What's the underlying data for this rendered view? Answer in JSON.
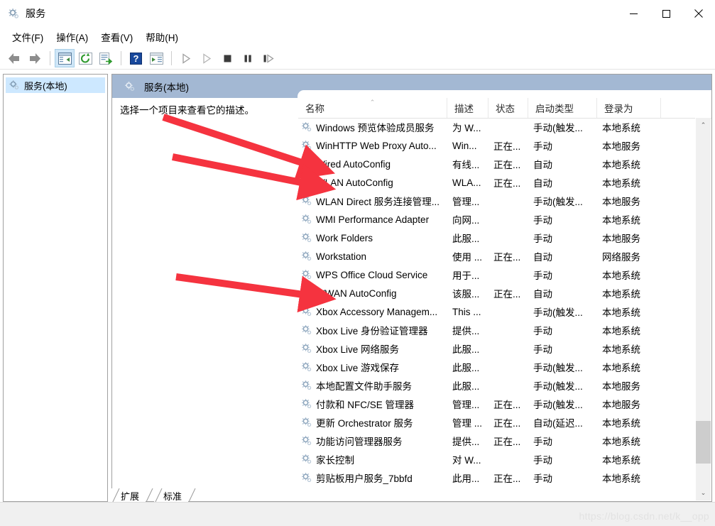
{
  "window": {
    "title": "服务",
    "icon": "services-gear-icon",
    "minimize_label": "最小化",
    "maximize_label": "最大化",
    "close_label": "关闭"
  },
  "menubar": {
    "items": [
      {
        "label": "文件(F)",
        "name": "menu-file"
      },
      {
        "label": "操作(A)",
        "name": "menu-action"
      },
      {
        "label": "查看(V)",
        "name": "menu-view"
      },
      {
        "label": "帮助(H)",
        "name": "menu-help"
      }
    ]
  },
  "toolbar": {
    "buttons": [
      {
        "name": "back-icon",
        "icon": "arrow-left"
      },
      {
        "name": "forward-icon",
        "icon": "arrow-right"
      },
      {
        "name": "show-hide-console-tree-icon",
        "icon": "panel"
      },
      {
        "name": "refresh-icon",
        "icon": "refresh"
      },
      {
        "name": "export-list-icon",
        "icon": "export"
      },
      {
        "name": "help-icon",
        "icon": "help"
      },
      {
        "name": "show-action-pane-icon",
        "icon": "action-panel"
      },
      {
        "name": "start-service-icon",
        "icon": "play"
      },
      {
        "name": "resume-service-icon",
        "icon": "play-outline"
      },
      {
        "name": "stop-service-icon",
        "icon": "stop"
      },
      {
        "name": "pause-service-icon",
        "icon": "pause"
      },
      {
        "name": "restart-service-icon",
        "icon": "restart"
      }
    ]
  },
  "tree": {
    "node_label": "服务(本地)",
    "node_icon": "services-gear-icon"
  },
  "pane": {
    "banner_title": "服务(本地)",
    "banner_icon": "services-gear-icon",
    "description_hint": "选择一个项目来查看它的描述。"
  },
  "list": {
    "columns": [
      {
        "label": "名称",
        "name": "column-name",
        "sorted": "asc"
      },
      {
        "label": "描述",
        "name": "column-description"
      },
      {
        "label": "状态",
        "name": "column-status"
      },
      {
        "label": "启动类型",
        "name": "column-startup-type"
      },
      {
        "label": "登录为",
        "name": "column-log-on-as"
      }
    ],
    "rows": [
      {
        "name": "Windows 预览体验成员服务",
        "description": "为 W...",
        "status": "",
        "startup": "手动(触发...",
        "logon": "本地系统"
      },
      {
        "name": "WinHTTP Web Proxy Auto...",
        "description": "Win...",
        "status": "正在...",
        "startup": "手动",
        "logon": "本地服务"
      },
      {
        "name": "Wired AutoConfig",
        "description": "有线...",
        "status": "正在...",
        "startup": "自动",
        "logon": "本地系统"
      },
      {
        "name": "WLAN AutoConfig",
        "description": "WLA...",
        "status": "正在...",
        "startup": "自动",
        "logon": "本地系统"
      },
      {
        "name": "WLAN Direct 服务连接管理...",
        "description": "管理...",
        "status": "",
        "startup": "手动(触发...",
        "logon": "本地服务"
      },
      {
        "name": "WMI Performance Adapter",
        "description": "向网...",
        "status": "",
        "startup": "手动",
        "logon": "本地系统"
      },
      {
        "name": "Work Folders",
        "description": "此服...",
        "status": "",
        "startup": "手动",
        "logon": "本地服务"
      },
      {
        "name": "Workstation",
        "description": "使用 ...",
        "status": "正在...",
        "startup": "自动",
        "logon": "网络服务"
      },
      {
        "name": "WPS Office Cloud Service",
        "description": "用于...",
        "status": "",
        "startup": "手动",
        "logon": "本地系统"
      },
      {
        "name": "WWAN AutoConfig",
        "description": "该服...",
        "status": "正在...",
        "startup": "自动",
        "logon": "本地系统"
      },
      {
        "name": "Xbox Accessory Managem...",
        "description": "This ...",
        "status": "",
        "startup": "手动(触发...",
        "logon": "本地系统"
      },
      {
        "name": "Xbox Live 身份验证管理器",
        "description": "提供...",
        "status": "",
        "startup": "手动",
        "logon": "本地系统"
      },
      {
        "name": "Xbox Live 网络服务",
        "description": "此服...",
        "status": "",
        "startup": "手动",
        "logon": "本地系统"
      },
      {
        "name": "Xbox Live 游戏保存",
        "description": "此服...",
        "status": "",
        "startup": "手动(触发...",
        "logon": "本地系统"
      },
      {
        "name": "本地配置文件助手服务",
        "description": "此服...",
        "status": "",
        "startup": "手动(触发...",
        "logon": "本地服务"
      },
      {
        "name": "付款和 NFC/SE 管理器",
        "description": "管理...",
        "status": "正在...",
        "startup": "手动(触发...",
        "logon": "本地服务"
      },
      {
        "name": "更新 Orchestrator 服务",
        "description": "管理 ...",
        "status": "正在...",
        "startup": "自动(延迟...",
        "logon": "本地系统"
      },
      {
        "name": "功能访问管理器服务",
        "description": "提供...",
        "status": "正在...",
        "startup": "手动",
        "logon": "本地系统"
      },
      {
        "name": "家长控制",
        "description": "对 W...",
        "status": "",
        "startup": "手动",
        "logon": "本地系统"
      },
      {
        "name": "剪贴板用户服务_7bbfd",
        "description": "此用...",
        "status": "正在...",
        "startup": "手动",
        "logon": "本地系统"
      }
    ]
  },
  "tabs": [
    {
      "label": "扩展",
      "name": "tab-extended",
      "selected": false
    },
    {
      "label": "标准",
      "name": "tab-standard",
      "selected": true
    }
  ],
  "scrollbar": {
    "up_arrow": "⌃",
    "down_arrow": "⌄"
  },
  "watermark": {
    "text": "https://blog.csdn.net/k__opp"
  },
  "annotations": {
    "arrow_color": "#f5333f",
    "arrows": [
      {
        "name": "arrow-to-wired-autoconfig",
        "target": "Wired AutoConfig"
      },
      {
        "name": "arrow-to-wlan-autoconfig",
        "target": "WLAN AutoConfig"
      },
      {
        "name": "arrow-to-wwan-autoconfig",
        "target": "WWAN AutoConfig"
      }
    ]
  }
}
